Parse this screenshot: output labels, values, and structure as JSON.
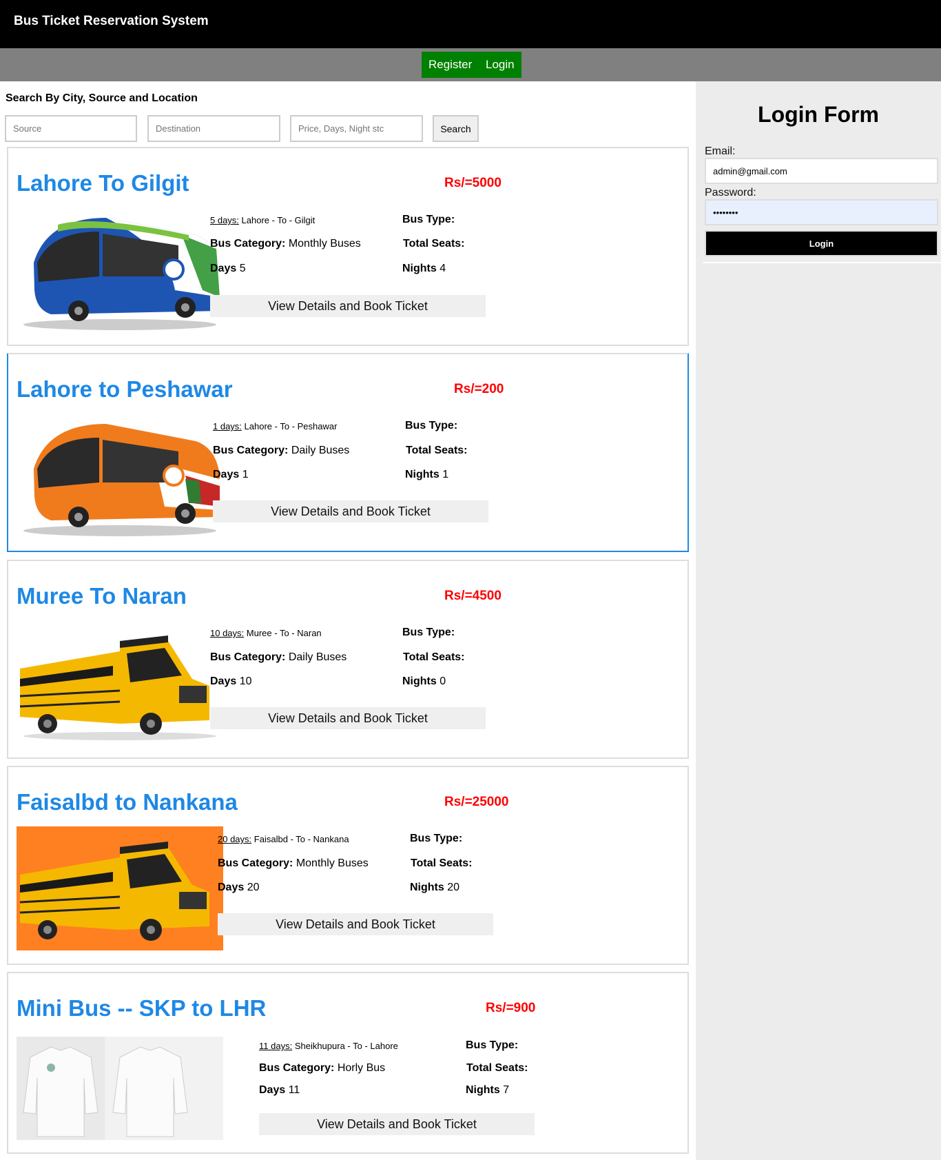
{
  "app": {
    "title": "Bus Ticket Reservation System"
  },
  "nav": {
    "register": "Register",
    "login": "Login"
  },
  "search": {
    "heading": "Search By City, Source and Location",
    "source_placeholder": "Source",
    "destination_placeholder": "Destination",
    "filter_placeholder": "Price, Days, Night stc",
    "button": "Search"
  },
  "labels": {
    "bus_type": "Bus Type:",
    "total_seats": "Total Seats:",
    "bus_category": "Bus Category:",
    "days": "Days",
    "nights": "Nights",
    "to": " - To - ",
    "book": "View Details and Book Ticket"
  },
  "trips": [
    {
      "title": "Lahore To Gilgit",
      "price": "Rs/=5000",
      "days_label": "5 days:",
      "from": "Lahore",
      "to": "Gilgit",
      "category": "Monthly Buses",
      "days": "5",
      "nights": "4",
      "image": "bus-green-blue"
    },
    {
      "title": "Lahore to Peshawar",
      "price": "Rs/=200",
      "days_label": "1 days:",
      "from": "Lahore",
      "to": "Peshawar",
      "category": "Daily Buses",
      "days": "1",
      "nights": "1",
      "image": "bus-orange"
    },
    {
      "title": "Muree To Naran",
      "price": "Rs/=4500",
      "days_label": "10 days:",
      "from": "Muree",
      "to": "Naran",
      "category": "Daily Buses",
      "days": "10",
      "nights": "0",
      "image": "school-bus"
    },
    {
      "title": "Faisalbd to Nankana",
      "price": "Rs/=25000",
      "days_label": "20 days:",
      "from": "Faisalbd",
      "to": "Nankana",
      "category": "Monthly Buses",
      "days": "20",
      "nights": "20",
      "image": "school-bus-orange-bg"
    },
    {
      "title": "Mini Bus -- SKP to LHR",
      "price": "Rs/=900",
      "days_label": "11 days:",
      "from": "Sheikhupura",
      "to": "Lahore",
      "category": "Horly Bus",
      "days": "11",
      "nights": "7",
      "image": "shirts"
    }
  ],
  "login_form": {
    "heading": "Login Form",
    "email_label": "Email:",
    "email_value": "admin@gmail.com",
    "password_label": "Password:",
    "password_value": "••••••••",
    "submit": "Login"
  },
  "colors": {
    "accent": "#1e88e5",
    "price": "#ff0000",
    "nav_button": "#008000"
  }
}
